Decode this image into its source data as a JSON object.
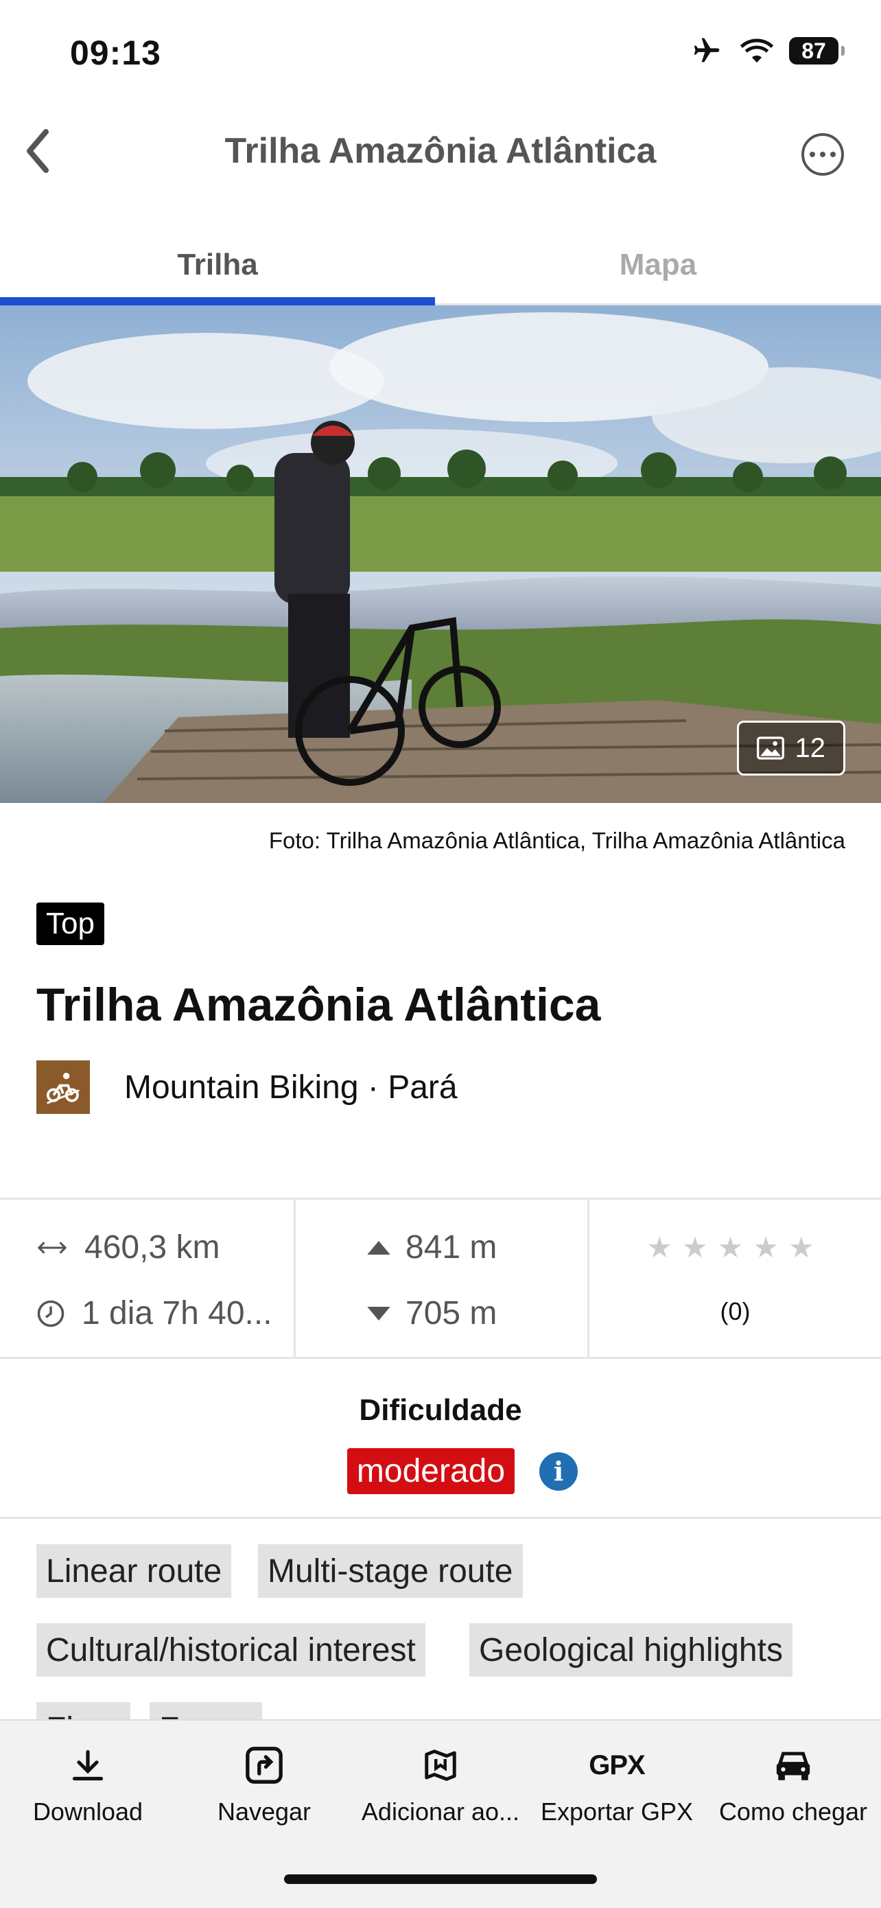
{
  "status_bar": {
    "time": "09:13",
    "battery": "87",
    "icons": [
      "airplane-icon",
      "wifi-icon",
      "battery-icon"
    ]
  },
  "nav": {
    "title": "Trilha Amazônia Atlântica",
    "back_icon": "chevron-left-icon",
    "more_icon": "more-icon"
  },
  "tabs": [
    {
      "label": "Trilha",
      "active": true
    },
    {
      "label": "Mapa",
      "active": false
    }
  ],
  "hero": {
    "photo_count": "12",
    "caption": "Foto: Trilha Amazônia Atlântica, Trilha Amazônia Atlântica"
  },
  "trail": {
    "badge": "Top",
    "title": "Trilha Amazônia Atlântica",
    "activity": "Mountain Biking · Pará",
    "activity_icon": "mountain-bike-icon"
  },
  "stats": {
    "distance": "460,3 km",
    "duration": "1 dia 7h 40...",
    "ascent": "841 m",
    "descent": "705 m",
    "rating": 0,
    "rating_count": "(0)"
  },
  "difficulty": {
    "label": "Dificuldade",
    "value": "moderado",
    "color": "#d40d12"
  },
  "tags": [
    "Linear route",
    "Multi-stage route",
    "Cultural/historical interest",
    "Geological highlights",
    "Flora",
    "Fauna"
  ],
  "toolbar": [
    {
      "label": "Download",
      "icon": "download-icon"
    },
    {
      "label": "Navegar",
      "icon": "navigate-icon"
    },
    {
      "label": "Adicionar ao...",
      "icon": "map-bookmark-icon"
    },
    {
      "label": "Exportar GPX",
      "icon": "gpx-icon"
    },
    {
      "label": "Como chegar",
      "icon": "car-icon"
    }
  ],
  "colors": {
    "accent": "#1d4fd1",
    "info": "#1f6fb2",
    "activity": "#8b5a2b"
  }
}
